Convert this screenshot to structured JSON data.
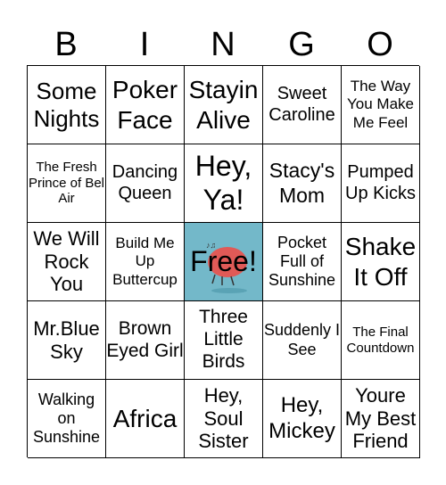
{
  "header": [
    "B",
    "I",
    "N",
    "G",
    "O"
  ],
  "cells": [
    "Some Nights",
    "Poker Face",
    "Stayin Alive",
    "Sweet Caroline",
    "The Way You Make Me Feel",
    "The Fresh Prince of Bel Air",
    "Dancing Queen",
    "Hey, Ya!",
    "Stacy's Mom",
    "Pumped Up Kicks",
    "We Will Rock You",
    "Build Me Up Buttercup",
    "Free!",
    "Pocket Full of Sunshine",
    "Shake It Off",
    "Mr.Blue Sky",
    "Brown Eyed Girl",
    "Three Little Birds",
    "Suddenly I See",
    "The Final Countdown",
    "Walking on Sunshine",
    "Africa",
    "Hey, Soul Sister",
    "Hey, Mickey",
    "Youre My Best Friend"
  ],
  "free_cell": {
    "index": 12,
    "background": "#73b8c9",
    "icon": "singing-brain-icon"
  }
}
